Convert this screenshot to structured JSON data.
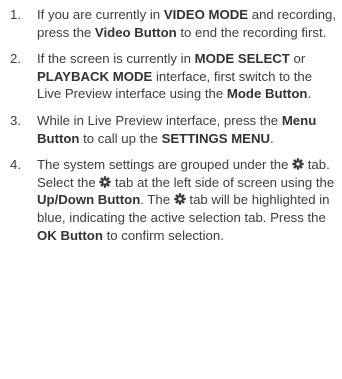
{
  "steps": [
    {
      "num": "1.",
      "parts": [
        {
          "t": "If you are currently in "
        },
        {
          "b": "VIDEO MODE"
        },
        {
          "t": " and recording, press the "
        },
        {
          "b": "Video Button"
        },
        {
          "t": " to end the recording first."
        }
      ]
    },
    {
      "num": "2.",
      "parts": [
        {
          "t": "If the screen is currently in "
        },
        {
          "b": "MODE SELECT"
        },
        {
          "t": " or "
        },
        {
          "b": "PLAYBACK MODE"
        },
        {
          "t": " interface, first switch to the Live Preview interface using the "
        },
        {
          "b": "Mode Button"
        },
        {
          "t": "."
        }
      ]
    },
    {
      "num": "3.",
      "parts": [
        {
          "t": "While in Live Preview interface, press the "
        },
        {
          "b": "Menu Button"
        },
        {
          "t": " to call up the "
        },
        {
          "b": "SETTINGS MENU"
        },
        {
          "t": "."
        }
      ]
    },
    {
      "num": "4.",
      "parts": [
        {
          "t": "The system settings are grouped under the "
        },
        {
          "icon": "gear-icon"
        },
        {
          "t": " tab. Select the "
        },
        {
          "icon": "gear-icon"
        },
        {
          "t": " tab at the left side of screen using the "
        },
        {
          "b": "Up/Down Button"
        },
        {
          "t": ". The "
        },
        {
          "icon": "gear-icon"
        },
        {
          "t": " tab will be highlighted in blue, indicating the active selection tab. Press the "
        },
        {
          "b": "OK Button"
        },
        {
          "t": " to confirm selection."
        }
      ]
    }
  ]
}
